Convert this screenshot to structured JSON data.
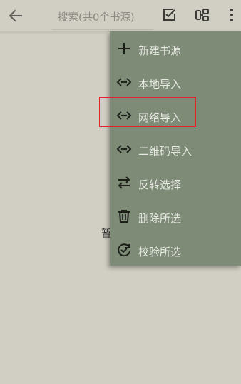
{
  "toolbar": {
    "back_icon": "arrow-left-icon",
    "search_placeholder": "搜索(共0个书源)",
    "actions": [
      {
        "name": "select-all",
        "icon": "checkbox-edit-icon"
      },
      {
        "name": "group",
        "icon": "group-icon"
      },
      {
        "name": "more",
        "icon": "more-vertical-icon"
      }
    ]
  },
  "empty_state": {
    "text": "暂"
  },
  "menu": {
    "items": [
      {
        "label": "新建书源",
        "icon": "plus-icon"
      },
      {
        "label": "本地导入",
        "icon": "code-import-icon"
      },
      {
        "label": "网络导入",
        "icon": "code-import-icon",
        "highlighted": true
      },
      {
        "label": "二维码导入",
        "icon": "code-import-icon"
      },
      {
        "label": "反转选择",
        "icon": "swap-arrows-icon"
      },
      {
        "label": "删除所选",
        "icon": "trash-icon"
      },
      {
        "label": "校验所选",
        "icon": "check-refresh-icon"
      }
    ]
  },
  "colors": {
    "background": "#d1cfc3",
    "menu_background": "#7d8b77",
    "menu_text": "#e6e8e1",
    "highlight": "#e0242a"
  }
}
